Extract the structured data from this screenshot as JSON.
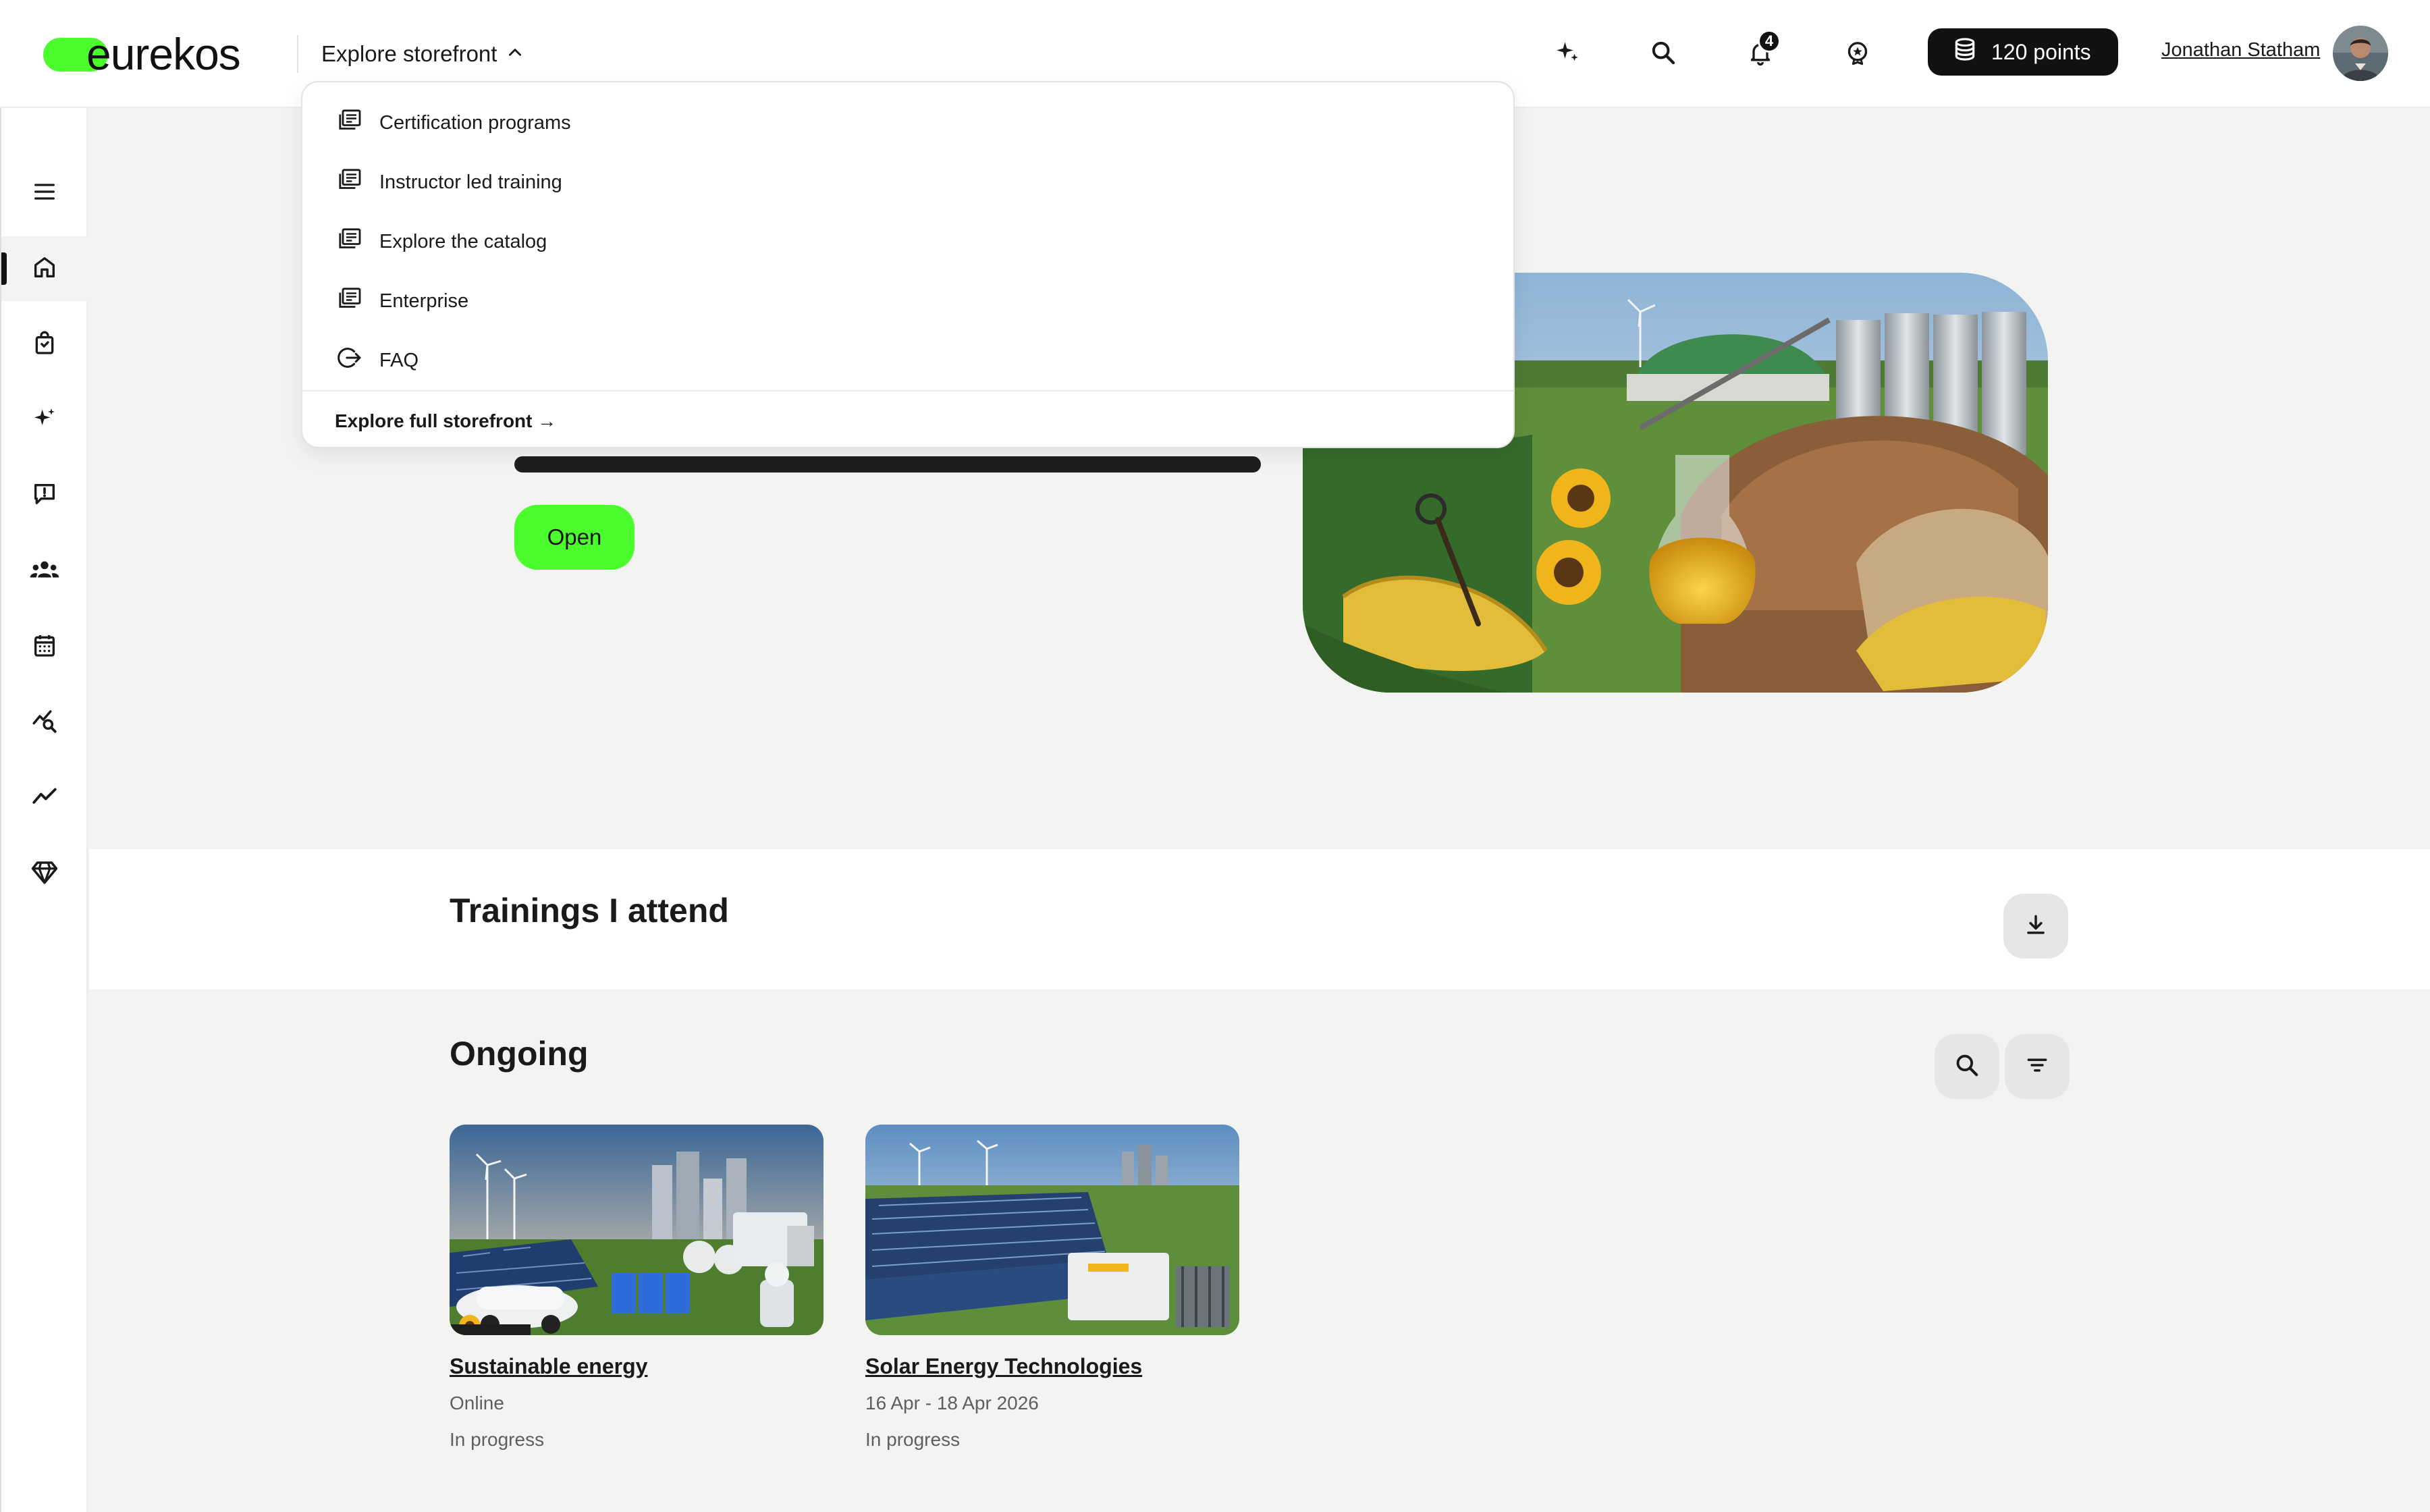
{
  "header": {
    "logo_text": "eurekos",
    "explore_label": "Explore storefront",
    "notifications_count": "4",
    "points_label": "120 points",
    "user_name": "Jonathan Statham"
  },
  "dropdown": {
    "items": [
      {
        "label": "Certification programs",
        "icon": "document-list-icon"
      },
      {
        "label": "Instructor led training",
        "icon": "document-list-icon"
      },
      {
        "label": "Explore the catalog",
        "icon": "document-list-icon"
      },
      {
        "label": "Enterprise",
        "icon": "document-list-icon"
      },
      {
        "label": "FAQ",
        "icon": "external-arrow-icon"
      }
    ],
    "footer_label": "Explore full storefront →"
  },
  "sidebar": {
    "items": [
      {
        "icon": "menu-icon"
      },
      {
        "icon": "home-icon",
        "active": true
      },
      {
        "icon": "shopping-bag-icon"
      },
      {
        "icon": "sparkle-icon"
      },
      {
        "icon": "feedback-icon"
      },
      {
        "icon": "groups-icon"
      },
      {
        "icon": "calendar-icon"
      },
      {
        "icon": "analytics-search-icon"
      },
      {
        "icon": "trend-icon"
      },
      {
        "icon": "diamond-icon"
      }
    ]
  },
  "hero": {
    "open_label": "Open"
  },
  "trainings": {
    "title": "Trainings I attend"
  },
  "ongoing": {
    "title": "Ongoing",
    "cards": [
      {
        "title": "Sustainable energy",
        "meta": "Online",
        "status": "In progress"
      },
      {
        "title": "Solar Energy Technologies",
        "meta": "16 Apr - 18 Apr 2026",
        "status": "In progress"
      }
    ]
  },
  "colors": {
    "brand_green": "#4cfd2e",
    "dark": "#111111",
    "page_bg": "#f3f3f2"
  }
}
